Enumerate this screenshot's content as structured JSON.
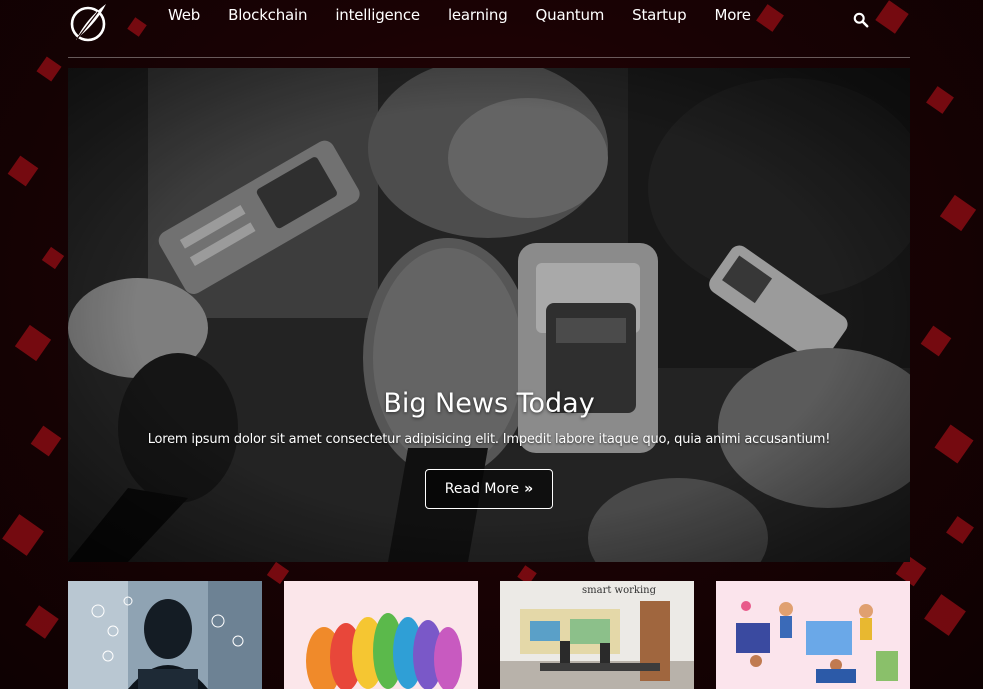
{
  "nav": {
    "logo_icon": "feather-quill-logo",
    "links": [
      "Web",
      "Blockchain",
      "intelligence",
      "learning",
      "Quantum",
      "Startup",
      "More"
    ],
    "search_icon": "search-icon"
  },
  "hero": {
    "title": "Big News Today",
    "text": "Lorem ipsum dolor sit amet consectetur adipisicing elit. Impedit labore itaque quo, quia animi accusantium!",
    "button_label": "Read More",
    "button_icon": "double-chevron-right-icon"
  },
  "cards": [
    {
      "image": "hacker-cybersecurity-image"
    },
    {
      "image": "colorful-silhouettes-image"
    },
    {
      "image": "smart-working-office-image",
      "caption": "smart working"
    },
    {
      "image": "people-illustration-image"
    }
  ],
  "colors": {
    "accent": "#c4121c",
    "background": "#1a0204",
    "text": "#ffffff"
  }
}
